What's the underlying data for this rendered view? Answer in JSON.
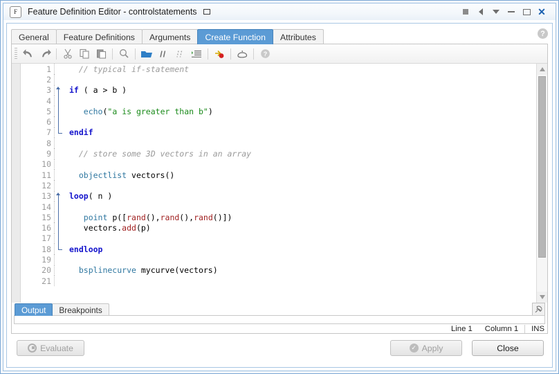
{
  "window": {
    "app_icon_letter": "F",
    "title": "Feature Definition Editor - controlstatements",
    "doc_icon": "document-icon",
    "buttons": [
      {
        "name": "stop-button",
        "glyph": "square"
      },
      {
        "name": "prev-button",
        "glyph": "left-arrow"
      },
      {
        "name": "dropdown-button",
        "glyph": "down-arrow"
      },
      {
        "name": "minimize-button",
        "glyph": "minimize"
      },
      {
        "name": "maximize-button",
        "glyph": "maximize"
      },
      {
        "name": "close-button",
        "glyph": "close",
        "label": "✕"
      }
    ]
  },
  "tabs": [
    {
      "label": "General",
      "active": false
    },
    {
      "label": "Feature Definitions",
      "active": false
    },
    {
      "label": "Arguments",
      "active": false
    },
    {
      "label": "Create Function",
      "active": true
    },
    {
      "label": "Attributes",
      "active": false
    }
  ],
  "help_glyph": "?",
  "toolbar": [
    {
      "name": "undo-icon",
      "tooltip": "Undo"
    },
    {
      "name": "redo-icon",
      "tooltip": "Redo"
    },
    {
      "name": "separator-1"
    },
    {
      "name": "cut-icon",
      "tooltip": "Cut"
    },
    {
      "name": "copy-icon",
      "tooltip": "Copy"
    },
    {
      "name": "paste-icon",
      "tooltip": "Paste"
    },
    {
      "name": "separator-2"
    },
    {
      "name": "search-icon",
      "tooltip": "Find"
    },
    {
      "name": "separator-3"
    },
    {
      "name": "open-folder-icon",
      "tooltip": "Open"
    },
    {
      "name": "comment-icon",
      "tooltip": "Comment"
    },
    {
      "name": "uncomment-icon",
      "tooltip": "Uncomment"
    },
    {
      "name": "indent-icon",
      "tooltip": "Indent"
    },
    {
      "name": "separator-4"
    },
    {
      "name": "breakpoint-icon",
      "tooltip": "Toggle breakpoint"
    },
    {
      "name": "separator-5"
    },
    {
      "name": "debug-icon",
      "tooltip": "Debug"
    },
    {
      "name": "separator-6"
    },
    {
      "name": "help-icon",
      "tooltip": "Help"
    }
  ],
  "editor": {
    "lines": [
      {
        "n": "1",
        "fold": "none",
        "tokens": [
          {
            "t": "com",
            "v": "  // typical if-statement"
          }
        ]
      },
      {
        "n": "2",
        "fold": "none",
        "tokens": []
      },
      {
        "n": "3",
        "fold": "start",
        "tokens": [
          {
            "t": "kw",
            "v": "if"
          },
          {
            "t": "pl",
            "v": " ( a > b )"
          }
        ]
      },
      {
        "n": "4",
        "fold": "mid",
        "tokens": []
      },
      {
        "n": "5",
        "fold": "mid",
        "tokens": [
          {
            "t": "pl",
            "v": "   "
          },
          {
            "t": "fn",
            "v": "echo"
          },
          {
            "t": "pl",
            "v": "("
          },
          {
            "t": "str",
            "v": "\"a is greater than b\""
          },
          {
            "t": "pl",
            "v": ")"
          }
        ]
      },
      {
        "n": "6",
        "fold": "mid",
        "tokens": []
      },
      {
        "n": "7",
        "fold": "end",
        "tokens": [
          {
            "t": "kw",
            "v": "endif"
          }
        ]
      },
      {
        "n": "8",
        "fold": "none",
        "tokens": []
      },
      {
        "n": "9",
        "fold": "none",
        "tokens": [
          {
            "t": "com",
            "v": "  // store some 3D vectors in an array"
          }
        ]
      },
      {
        "n": "10",
        "fold": "none",
        "tokens": []
      },
      {
        "n": "11",
        "fold": "none",
        "tokens": [
          {
            "t": "fn",
            "v": "  objectlist"
          },
          {
            "t": "pl",
            "v": " vectors()"
          }
        ]
      },
      {
        "n": "12",
        "fold": "none",
        "tokens": []
      },
      {
        "n": "13",
        "fold": "start",
        "tokens": [
          {
            "t": "kw",
            "v": "loop"
          },
          {
            "t": "pl",
            "v": "( n )"
          }
        ]
      },
      {
        "n": "14",
        "fold": "mid",
        "tokens": []
      },
      {
        "n": "15",
        "fold": "mid",
        "tokens": [
          {
            "t": "pl",
            "v": "   "
          },
          {
            "t": "fn",
            "v": "point"
          },
          {
            "t": "pl",
            "v": " p(["
          },
          {
            "t": "red",
            "v": "rand"
          },
          {
            "t": "pl",
            "v": "(),"
          },
          {
            "t": "red",
            "v": "rand"
          },
          {
            "t": "pl",
            "v": "(),"
          },
          {
            "t": "red",
            "v": "rand"
          },
          {
            "t": "pl",
            "v": "()])"
          }
        ]
      },
      {
        "n": "16",
        "fold": "mid",
        "tokens": [
          {
            "t": "pl",
            "v": "   vectors."
          },
          {
            "t": "red",
            "v": "add"
          },
          {
            "t": "pl",
            "v": "(p)"
          }
        ]
      },
      {
        "n": "17",
        "fold": "mid",
        "tokens": []
      },
      {
        "n": "18",
        "fold": "end",
        "tokens": [
          {
            "t": "kw",
            "v": "endloop"
          }
        ]
      },
      {
        "n": "19",
        "fold": "none",
        "tokens": []
      },
      {
        "n": "20",
        "fold": "none",
        "tokens": [
          {
            "t": "fn",
            "v": "  bsplinecurve"
          },
          {
            "t": "pl",
            "v": " mycurve(vectors)"
          }
        ]
      },
      {
        "n": "21",
        "fold": "none",
        "tokens": []
      }
    ],
    "colors": {
      "comment": "#9b9b9b",
      "keyword": "#1414cc",
      "function": "#2f77a0",
      "string": "#1a8a1a",
      "builtin": "#a02020",
      "plain": "#000000",
      "gutter_text": "#9a9a9a"
    }
  },
  "output": {
    "tabs": [
      {
        "label": "Output",
        "active": true
      },
      {
        "label": "Breakpoints",
        "active": false
      }
    ],
    "pin_icon": "pin-icon",
    "content": ""
  },
  "status": {
    "line": "Line 1",
    "column": "Column 1",
    "mode": "INS"
  },
  "footer": {
    "evaluate_label": "Evaluate",
    "apply_label": "Apply",
    "close_label": "Close"
  },
  "theme": {
    "accent": "#5b9bd5",
    "window_border": "#7ba7d4",
    "close_x": "#1b60b0"
  }
}
